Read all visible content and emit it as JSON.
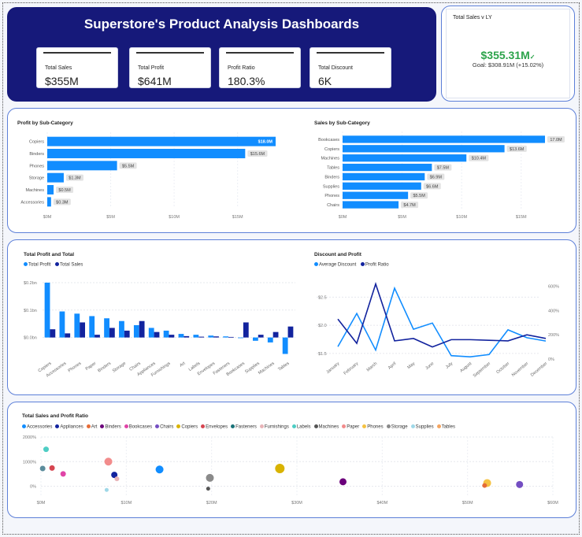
{
  "header": {
    "title": "Superstore's Product Analysis Dashboards",
    "kpis": [
      {
        "label": "Total Sales",
        "value": "$355M"
      },
      {
        "label": "Total Profit",
        "value": "$641M"
      },
      {
        "label": "Profit Ratio",
        "value": "180.3%"
      },
      {
        "label": "Total Discount",
        "value": "6K"
      }
    ]
  },
  "gauge": {
    "title": "Total Sales v LY",
    "value": "$355.31M",
    "goal": "Goal: $308.91M (+15.02%)",
    "accent": "#2ba34a"
  },
  "chart_data": [
    {
      "id": "profit-sub",
      "type": "bar",
      "orientation": "horizontal",
      "title": "Profit by Sub-Category",
      "categories": [
        "Copiers",
        "Binders",
        "Phones",
        "Storage",
        "Machines",
        "Accessories"
      ],
      "values": [
        18.0,
        15.6,
        5.5,
        1.3,
        0.5,
        0.3
      ],
      "labels": [
        "$18.0M",
        "$15.6M",
        "$5.5M",
        "$1.3M",
        "$0.5M",
        "$0.3M"
      ],
      "xlim": [
        0,
        18
      ],
      "xticks": [
        0,
        5,
        10,
        15
      ],
      "xtick_labels": [
        "$0M",
        "$5M",
        "$10M",
        "$15M"
      ],
      "color": "#118dff"
    },
    {
      "id": "sales-sub",
      "type": "bar",
      "orientation": "horizontal",
      "title": "Sales by Sub-Category",
      "categories": [
        "Bookcases",
        "Copiers",
        "Machines",
        "Tables",
        "Binders",
        "Supplies",
        "Phones",
        "Chairs"
      ],
      "values": [
        17.0,
        13.6,
        10.4,
        7.5,
        6.9,
        6.6,
        5.5,
        4.7
      ],
      "labels": [
        "17.0M",
        "$13.6M",
        "$10.4M",
        "$7.5M",
        "$6.9M",
        "$6.6M",
        "$5.5M",
        "$4.7M"
      ],
      "xlim": [
        0,
        17
      ],
      "xticks": [
        0,
        5,
        10,
        15
      ],
      "xtick_labels": [
        "$0M",
        "$5M",
        "$10M",
        "$15M"
      ],
      "color": "#118dff"
    },
    {
      "id": "profit-total",
      "type": "bar",
      "title": "Total Profit and Total",
      "categories": [
        "Copiers",
        "Accessories",
        "Phones",
        "Paper",
        "Binders",
        "Storage",
        "Chairs",
        "Appliances",
        "Furnishings",
        "Art",
        "Labels",
        "Envelopes",
        "Fasteners",
        "Bookcases",
        "Supplies",
        "Machines",
        "Tables"
      ],
      "series": [
        {
          "name": "Total Profit",
          "color": "#118dff",
          "values": [
            0.2,
            0.095,
            0.087,
            0.078,
            0.07,
            0.06,
            0.045,
            0.035,
            0.025,
            0.013,
            0.01,
            0.007,
            0.004,
            -0.002,
            -0.012,
            -0.018,
            -0.06
          ]
        },
        {
          "name": "Total Sales",
          "color": "#12239e",
          "values": [
            0.03,
            0.015,
            0.055,
            0.01,
            0.035,
            0.025,
            0.06,
            0.02,
            0.01,
            0.005,
            0.003,
            0.004,
            0.002,
            0.055,
            0.01,
            0.02,
            0.04
          ]
        }
      ],
      "ylim": [
        -0.07,
        0.22
      ],
      "yticks": [
        0,
        0.1,
        0.2
      ],
      "ytick_labels": [
        "$0.0bn",
        "$0.1bn",
        "$0.2bn"
      ]
    },
    {
      "id": "discount-profit",
      "type": "line",
      "title": "Discount and Profit",
      "categories": [
        "January",
        "February",
        "March",
        "April",
        "May",
        "June",
        "July",
        "August",
        "September",
        "October",
        "November",
        "December"
      ],
      "series": [
        {
          "name": "Average Discount",
          "color": "#118dff",
          "axis": "left",
          "values": [
            1.62,
            2.21,
            1.56,
            2.66,
            1.93,
            2.04,
            1.46,
            1.44,
            1.48,
            1.92,
            1.78,
            1.72
          ]
        },
        {
          "name": "Profit Ratio",
          "color": "#12239e",
          "axis": "right",
          "values": [
            330,
            130,
            620,
            150,
            170,
            100,
            160,
            160,
            155,
            150,
            200,
            170
          ]
        }
      ],
      "ylim_left": [
        1.4,
        2.8
      ],
      "yticks_left": [
        1.5,
        2.0,
        2.5
      ],
      "ytick_labels_left": [
        "$1.5",
        "$2.0",
        "$2.5"
      ],
      "ylim_right": [
        0,
        650
      ],
      "yticks_right": [
        0,
        200,
        400,
        600
      ],
      "ytick_labels_right": [
        "0%",
        "200%",
        "400%",
        "600%"
      ]
    },
    {
      "id": "sales-profit-ratio",
      "type": "scatter",
      "title": "Total Sales and Profit Ratio",
      "xlim": [
        0,
        60
      ],
      "xticks": [
        0,
        10,
        20,
        30,
        40,
        50,
        60
      ],
      "xtick_labels": [
        "$0M",
        "$10M",
        "$20M",
        "$30M",
        "$40M",
        "$50M",
        "$60M"
      ],
      "ylim": [
        -400,
        2000
      ],
      "yticks": [
        0,
        1000,
        2000
      ],
      "ytick_labels": [
        "0%",
        "1000%",
        "2000%"
      ],
      "legend": [
        {
          "name": "Accessories",
          "color": "#118dff"
        },
        {
          "name": "Appliances",
          "color": "#12239e"
        },
        {
          "name": "Art",
          "color": "#e66c37"
        },
        {
          "name": "Binders",
          "color": "#6b007b"
        },
        {
          "name": "Bookcases",
          "color": "#e044a7"
        },
        {
          "name": "Chairs",
          "color": "#744ec2"
        },
        {
          "name": "Copiers",
          "color": "#d9b300"
        },
        {
          "name": "Envelopes",
          "color": "#d64550"
        },
        {
          "name": "Fasteners",
          "color": "#197278"
        },
        {
          "name": "Furnishings",
          "color": "#e8b4b8"
        },
        {
          "name": "Labels",
          "color": "#4ecdc4"
        },
        {
          "name": "Machines",
          "color": "#555555"
        },
        {
          "name": "Paper",
          "color": "#f28c8c"
        },
        {
          "name": "Phones",
          "color": "#f5c242"
        },
        {
          "name": "Storage",
          "color": "#8a8a8a"
        },
        {
          "name": "Supplies",
          "color": "#9fd8e8"
        },
        {
          "name": "Tables",
          "color": "#f4a460"
        }
      ],
      "points": [
        {
          "x": 0.6,
          "y": 1500,
          "r": 3.5,
          "color": "#4ecdc4"
        },
        {
          "x": 0.2,
          "y": 720,
          "r": 3.5,
          "color": "#5b8c9c"
        },
        {
          "x": 1.3,
          "y": 740,
          "r": 3.5,
          "color": "#d64550"
        },
        {
          "x": 2.6,
          "y": 500,
          "r": 3.5,
          "color": "#e044a7"
        },
        {
          "x": 7.9,
          "y": 1000,
          "r": 5,
          "color": "#f28c8c"
        },
        {
          "x": 8.6,
          "y": 460,
          "r": 4,
          "color": "#12239e"
        },
        {
          "x": 8.9,
          "y": 300,
          "r": 3,
          "color": "#e8b4b8"
        },
        {
          "x": 7.7,
          "y": -150,
          "r": 2.5,
          "color": "#9fd8e8"
        },
        {
          "x": 13.9,
          "y": 680,
          "r": 5,
          "color": "#118dff"
        },
        {
          "x": 19.8,
          "y": 340,
          "r": 5,
          "color": "#8a8a8a"
        },
        {
          "x": 19.6,
          "y": -100,
          "r": 2.5,
          "color": "#555555"
        },
        {
          "x": 28.0,
          "y": 720,
          "r": 6,
          "color": "#d9b300"
        },
        {
          "x": 35.4,
          "y": 180,
          "r": 4.5,
          "color": "#6b007b"
        },
        {
          "x": 52.3,
          "y": 130,
          "r": 5,
          "color": "#f5c242"
        },
        {
          "x": 52.0,
          "y": 30,
          "r": 3,
          "color": "#e66c37"
        },
        {
          "x": 56.1,
          "y": 70,
          "r": 4.5,
          "color": "#744ec2"
        }
      ]
    }
  ]
}
